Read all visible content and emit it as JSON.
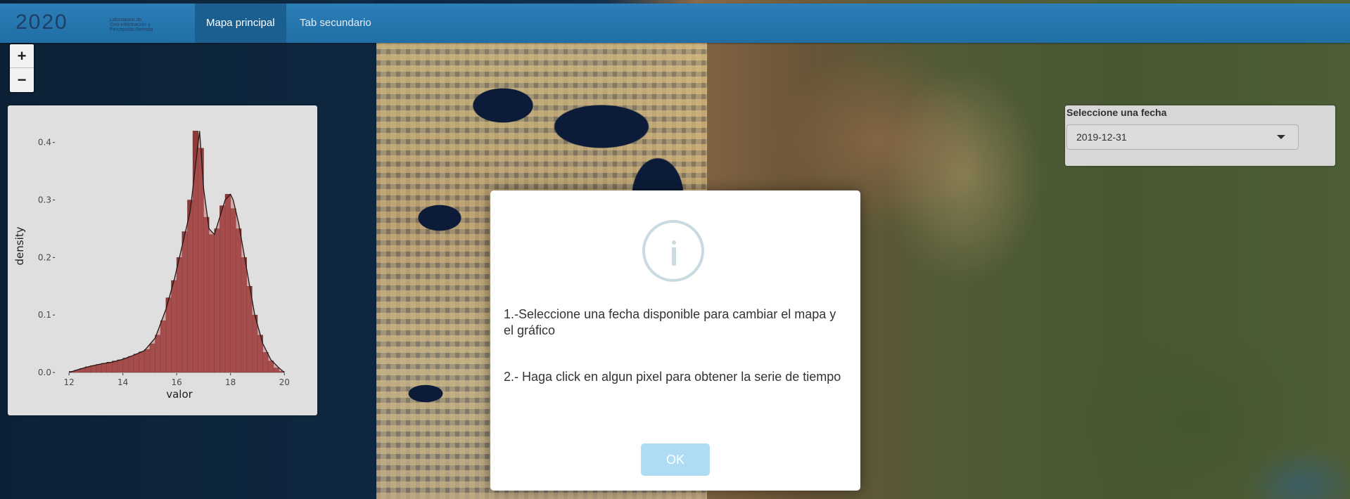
{
  "navbar": {
    "logo_digits": "2020",
    "logo_text": [
      "Laboratorio de",
      "Geo-Información y",
      "Percepción Remota"
    ],
    "tabs": [
      {
        "label": "Mapa principal",
        "active": true
      },
      {
        "label": "Tab secundario",
        "active": false
      }
    ],
    "colors": {
      "bar": "#2570a8",
      "active_tab": "#1a5f90"
    }
  },
  "zoom": {
    "in_label": "+",
    "out_label": "−"
  },
  "chart_data": {
    "type": "area",
    "xlabel": "valor",
    "ylabel": "density",
    "xlim": [
      11.5,
      20.7
    ],
    "ylim": [
      0,
      0.44
    ],
    "x_ticks": [
      12,
      14,
      16,
      18,
      20
    ],
    "y_ticks": [
      0.0,
      0.1,
      0.2,
      0.3,
      0.4
    ],
    "y_tick_labels": [
      "0.0",
      "0.1",
      "0.2",
      "0.3",
      "0.4"
    ],
    "histogram": {
      "bin_width": 0.2,
      "bin_starts": [
        12.0,
        12.2,
        12.4,
        12.6,
        12.8,
        13.0,
        13.2,
        13.4,
        13.6,
        13.8,
        14.0,
        14.2,
        14.4,
        14.6,
        14.8,
        15.0,
        15.2,
        15.4,
        15.6,
        15.8,
        16.0,
        16.2,
        16.4,
        16.6,
        16.8,
        17.0,
        17.2,
        17.4,
        17.6,
        17.8,
        18.0,
        18.2,
        18.4,
        18.6,
        18.8,
        19.0,
        19.2,
        19.4,
        19.6,
        19.8
      ],
      "values": [
        0.002,
        0.004,
        0.007,
        0.01,
        0.012,
        0.014,
        0.016,
        0.018,
        0.02,
        0.022,
        0.025,
        0.028,
        0.032,
        0.036,
        0.04,
        0.05,
        0.065,
        0.09,
        0.13,
        0.16,
        0.2,
        0.245,
        0.3,
        0.42,
        0.39,
        0.27,
        0.24,
        0.25,
        0.29,
        0.31,
        0.285,
        0.25,
        0.2,
        0.15,
        0.1,
        0.065,
        0.035,
        0.02,
        0.008,
        0.002
      ]
    },
    "density_line": {
      "x": [
        12.0,
        12.4,
        12.8,
        13.2,
        13.6,
        14.0,
        14.4,
        14.8,
        15.2,
        15.6,
        15.9,
        16.2,
        16.5,
        16.7,
        16.85,
        17.0,
        17.2,
        17.4,
        17.6,
        17.8,
        18.0,
        18.1,
        18.3,
        18.6,
        18.9,
        19.2,
        19.5,
        19.8,
        20.0
      ],
      "y": [
        0.0,
        0.006,
        0.011,
        0.015,
        0.018,
        0.023,
        0.03,
        0.038,
        0.06,
        0.11,
        0.16,
        0.22,
        0.28,
        0.36,
        0.42,
        0.32,
        0.25,
        0.24,
        0.27,
        0.3,
        0.31,
        0.3,
        0.26,
        0.18,
        0.1,
        0.05,
        0.022,
        0.008,
        0.0
      ]
    },
    "colors": {
      "bar_fill": "#8e2b2b",
      "density_fill": "#c96a6a",
      "line": "#2a1818",
      "panel": "#ebebeb",
      "axis_text": "#4d4d4d"
    }
  },
  "date_selector": {
    "label": "Seleccione una fecha",
    "value": "2019-12-31"
  },
  "modal": {
    "message1": "1.-Seleccione una fecha disponible para cambiar el mapa y el gráfico",
    "message2": "2.- Haga click en algun pixel para obtener la serie de tiempo",
    "ok_label": "OK",
    "icon": "info-circle-icon",
    "colors": {
      "icon": "#c9dae1",
      "ok": "#addcf3"
    }
  }
}
